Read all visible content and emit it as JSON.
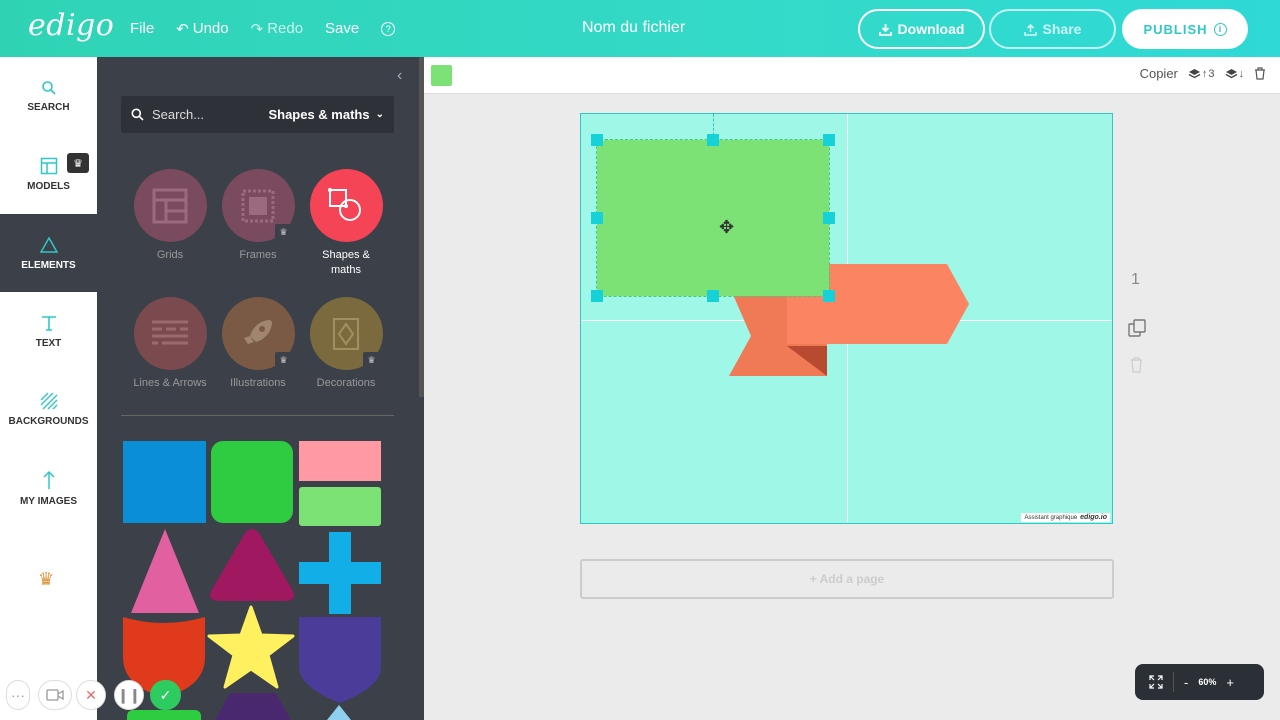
{
  "app": {
    "logo": "edigo",
    "filename": "Nom du fichier"
  },
  "menu": {
    "file": "File",
    "undo": "Undo",
    "redo": "Redo",
    "save": "Save",
    "help": "?"
  },
  "actions": {
    "download": "Download",
    "share": "Share",
    "publish": "PUBLISH",
    "publish_info": "i"
  },
  "nav": [
    {
      "label": "SEARCH",
      "icon": "search-icon"
    },
    {
      "label": "MODELS",
      "icon": "layout-icon"
    },
    {
      "label": "ELEMENTS",
      "icon": "triangle-icon"
    },
    {
      "label": "TEXT",
      "icon": "text-icon"
    },
    {
      "label": "BACKGROUNDS",
      "icon": "hatch-icon"
    },
    {
      "label": "MY IMAGES",
      "icon": "upload-arrow-icon"
    }
  ],
  "panel": {
    "search_placeholder": "Search...",
    "category_select": "Shapes & maths",
    "categories": [
      {
        "label": "Grids",
        "color": "#7a4a5e"
      },
      {
        "label": "Frames",
        "color": "#7a4a5e"
      },
      {
        "label": "Shapes & maths",
        "color": "#f44456"
      },
      {
        "label": "Lines & Arrows",
        "color": "#7a4a4e"
      },
      {
        "label": "Illustrations",
        "color": "#7a5a45"
      },
      {
        "label": "Decorations",
        "color": "#7a6a3e"
      }
    ]
  },
  "canvas_toolbar": {
    "selected_color": "#7de276",
    "copy": "Copier",
    "layer_up_count": "3"
  },
  "canvas": {
    "page_number": "1",
    "add_page": "+ Add a page",
    "watermark_prefix": "Assistant graphique",
    "watermark_brand": "edigo.io",
    "background": "#9ff7e8"
  },
  "zoom": {
    "minus": "-",
    "value": "60%",
    "plus": "+"
  },
  "colors": {
    "accent": "#2fc8c4",
    "shape_green": "#7de276",
    "ribbon": "#fb8563",
    "panel_bg": "#3c4049"
  }
}
